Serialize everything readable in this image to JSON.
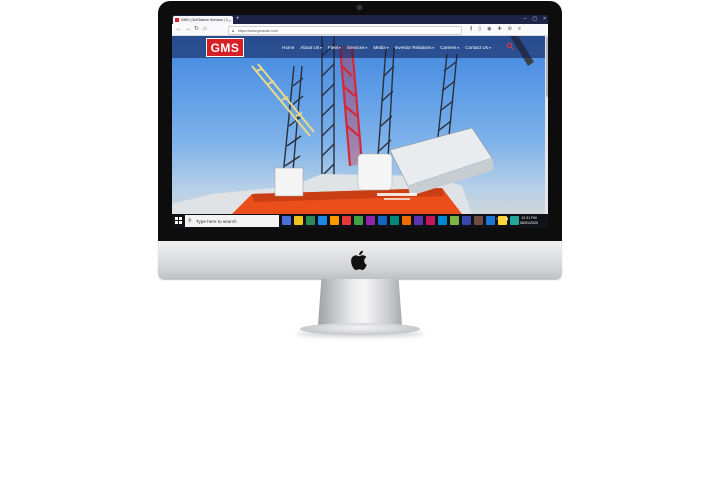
{
  "browser": {
    "tab_title": "GMS | Gulf Marine Services | C...",
    "tab_close": "×",
    "new_tab": "+",
    "url": "https://www.gmsuae.com",
    "window_controls": [
      "–",
      "▢",
      "×"
    ]
  },
  "site": {
    "logo_text": "GMS",
    "menu": [
      {
        "label": "Home",
        "has_caret": false
      },
      {
        "label": "About Us",
        "has_caret": true
      },
      {
        "label": "Fleet",
        "has_caret": true
      },
      {
        "label": "Services",
        "has_caret": true
      },
      {
        "label": "Media",
        "has_caret": true
      },
      {
        "label": "Investor Relations",
        "has_caret": true
      },
      {
        "label": "Careers",
        "has_caret": true
      },
      {
        "label": "Contact Us",
        "has_caret": true
      }
    ],
    "caret": "▾",
    "colors": {
      "brand_red": "#d71f26",
      "rig_orange": "#e94e1b",
      "nav_bg": "#1e2247"
    }
  },
  "taskbar": {
    "search_placeholder": "Type here to search",
    "search_icon": "⚲",
    "time": "12:31 PM",
    "date": "06/01/2020",
    "apps": [
      "#4a6fd6",
      "#f0c419",
      "#2e8b57",
      "#1e88e5",
      "#ff9800",
      "#e53935",
      "#43a047",
      "#8e24aa",
      "#1565c0",
      "#00897b",
      "#ef6c00",
      "#5e35b1",
      "#c2185b",
      "#0288d1",
      "#7cb342",
      "#3949ab",
      "#6d4c41",
      "#1976d2",
      "#fdd835",
      "#26a69a"
    ]
  }
}
